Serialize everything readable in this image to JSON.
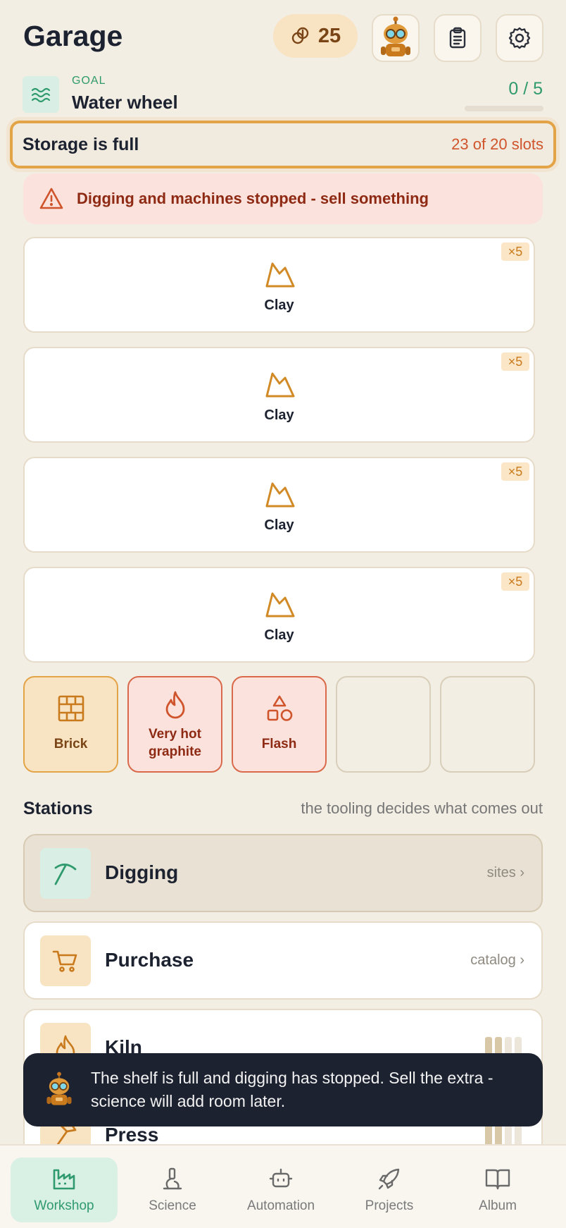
{
  "header": {
    "title": "Garage",
    "coins": "25",
    "icons": [
      "coin-icon",
      "robot-avatar",
      "clipboard-icon",
      "gear-icon"
    ]
  },
  "goal": {
    "caption": "GOAL",
    "name": "Water wheel",
    "progress": "0 / 5",
    "progress_fraction": 0
  },
  "storage": {
    "title": "Storage is full",
    "count": "23 of 20 slots"
  },
  "alert": {
    "text": "Digging and machines stopped - sell something"
  },
  "slots": [
    {
      "label": "Clay",
      "badge": "×5"
    },
    {
      "label": "Clay",
      "badge": "×5"
    },
    {
      "label": "Clay",
      "badge": "×5"
    },
    {
      "label": "Clay",
      "badge": "×5"
    }
  ],
  "tiles": [
    {
      "label": "Brick",
      "icon": "brick-icon"
    },
    {
      "label1": "Very hot",
      "label2": "graphite",
      "icon": "flame-icon"
    },
    {
      "label": "Flash",
      "icon": "shapes-icon"
    }
  ],
  "stations": {
    "title": "Stations",
    "subtitle": "the tooling decides what comes out",
    "items": [
      {
        "name": "Digging",
        "link": "sites ›",
        "icon": "pickaxe-icon"
      },
      {
        "name": "Purchase",
        "link": "catalog ›",
        "icon": "cart-icon"
      },
      {
        "name": "Kiln",
        "icon": "flame-icon"
      },
      {
        "name": "Press",
        "icon": "hammer-icon"
      }
    ]
  },
  "toast": {
    "text": "The shelf is full and digging has stopped. Sell the extra - science will add room later."
  },
  "nav": {
    "items": [
      {
        "label": "Workshop",
        "icon": "factory-icon"
      },
      {
        "label": "Science",
        "icon": "microscope-icon"
      },
      {
        "label": "Automation",
        "icon": "robot-icon"
      },
      {
        "label": "Projects",
        "icon": "rocket-icon"
      },
      {
        "label": "Album",
        "icon": "book-icon"
      }
    ]
  },
  "colors": {
    "background": "#f3eee4",
    "accent_green": "#2f9a6d",
    "accent_orange": "#e3a447",
    "alert_red": "#d0542b",
    "toast_bg": "#1d2230"
  }
}
